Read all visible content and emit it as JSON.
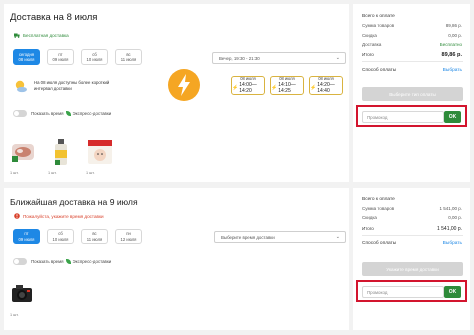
{
  "section1": {
    "title": "Доставка на 8 июля",
    "note": "Бесплатная доставка",
    "dates": [
      {
        "top": "сегодня",
        "bottom": "08 июля",
        "active": true
      },
      {
        "top": "пт",
        "bottom": "09 июля",
        "active": false
      },
      {
        "top": "сб",
        "bottom": "10 июля",
        "active": false
      },
      {
        "top": "вс",
        "bottom": "11 июля",
        "active": false
      }
    ],
    "time_select": "Вечер, 19:30 - 21:30",
    "express_text": "На 08 июля доступны более короткий интервал доставки",
    "slots": [
      {
        "date": "08 июля",
        "time": "14:00—14:20"
      },
      {
        "date": "08 июля",
        "time": "14:10—14:25"
      },
      {
        "date": "08 июля",
        "time": "14:20—14:40"
      }
    ],
    "toggle_label": "Показать время",
    "toggle_express": "Экспресс-доставки",
    "products": [
      {
        "qty": "1 шт."
      },
      {
        "qty": "1 шт."
      },
      {
        "qty": "1 шт."
      }
    ]
  },
  "section2": {
    "title": "Ближайшая доставка на 9 июля",
    "note": "Пожалуйста, укажите время доставки",
    "dates": [
      {
        "top": "пт",
        "bottom": "09 июля",
        "active": true
      },
      {
        "top": "сб",
        "bottom": "10 июля",
        "active": false
      },
      {
        "top": "вс",
        "bottom": "11 июля",
        "active": false
      },
      {
        "top": "пн",
        "bottom": "12 июля",
        "active": false
      }
    ],
    "time_select": "Выберите время доставки",
    "toggle_label": "Показать время",
    "toggle_express": "Экспресс-доставки",
    "products": [
      {
        "qty": "1 шт."
      }
    ]
  },
  "summary1": {
    "heading": "Всего к оплате",
    "rows": [
      {
        "label": "Сумма товаров",
        "value": "89,86 р."
      },
      {
        "label": "Скидка",
        "value": "0,00 р."
      },
      {
        "label": "Доставка",
        "value": "Бесплатно"
      }
    ],
    "total_label": "Итого",
    "total_value": "89,86 р.",
    "payment_label": "Способ оплаты",
    "payment_link": "Выбрать",
    "pay_button": "Выберите тип оплаты",
    "promo_placeholder": "Промокод",
    "ok_label": "OK"
  },
  "summary2": {
    "heading": "Всего к оплате",
    "rows": [
      {
        "label": "Сумма товаров",
        "value": "1 541,00 р."
      },
      {
        "label": "Скидка",
        "value": "0,00 р."
      }
    ],
    "total_label": "Итого",
    "total_value": "1 541,00 р.",
    "payment_label": "Способ оплаты",
    "payment_link": "Выбрать",
    "pay_button": "Укажите время доставки",
    "promo_placeholder": "Промокод",
    "ok_label": "OK"
  },
  "colors": {
    "accent_blue": "#1e88e5",
    "green": "#2e8b3a",
    "red_highlight": "#d3152e",
    "bolt": "#f5a623"
  }
}
